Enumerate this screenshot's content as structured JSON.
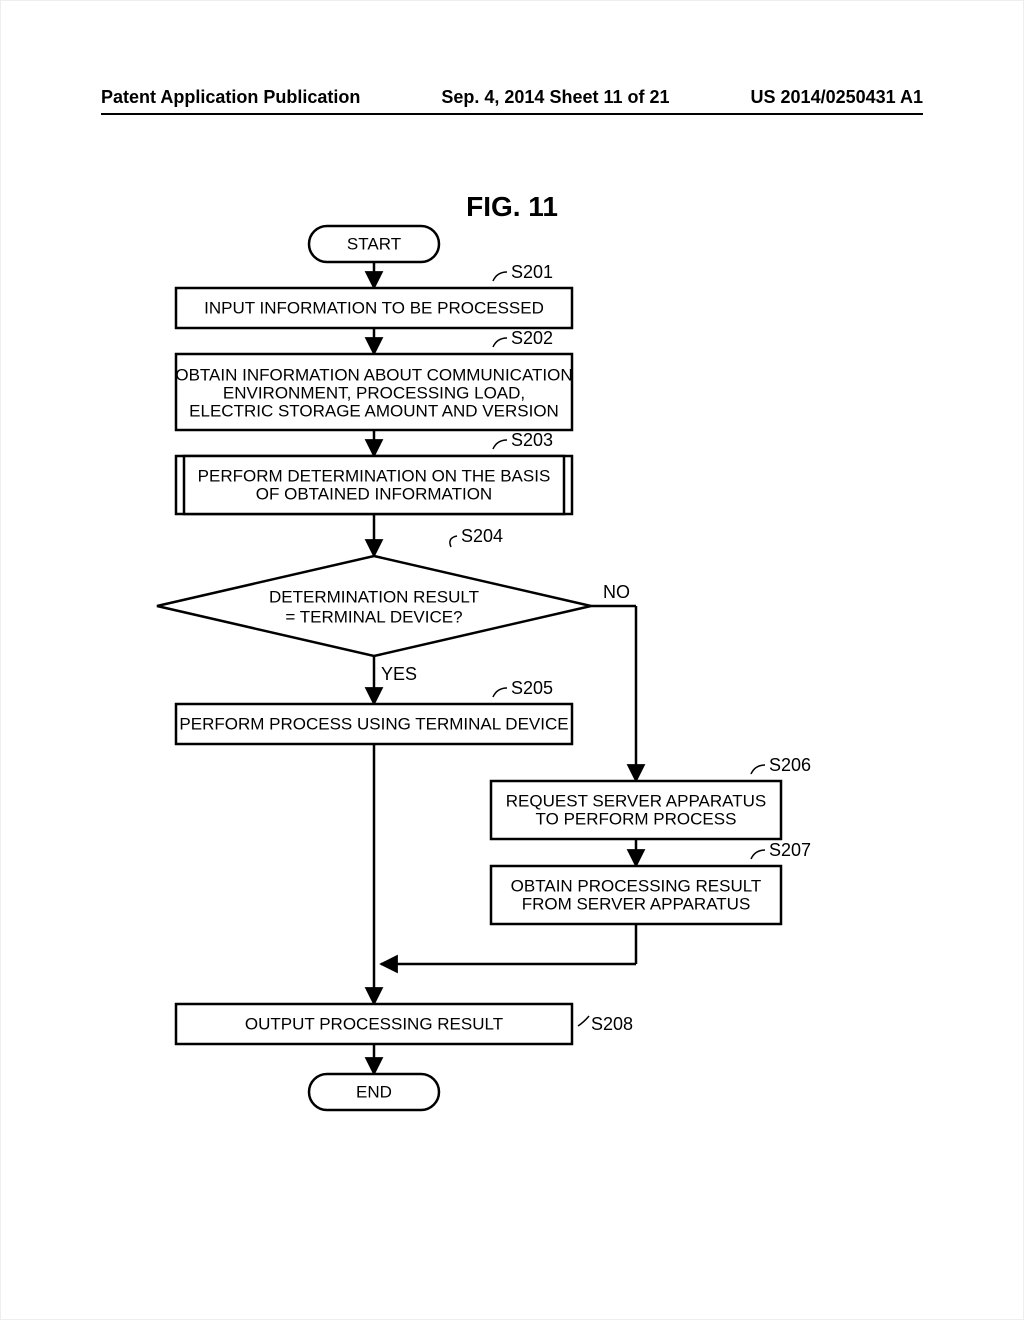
{
  "header": {
    "left": "Patent Application Publication",
    "center": "Sep. 4, 2014  Sheet 11 of 21",
    "right": "US 2014/0250431 A1"
  },
  "figure_title": "FIG. 11",
  "nodes": {
    "start": "START",
    "end": "END",
    "s201": "INPUT INFORMATION TO BE PROCESSED",
    "s202": "OBTAIN INFORMATION ABOUT COMMUNICATION ENVIRONMENT, PROCESSING LOAD, ELECTRIC STORAGE AMOUNT AND VERSION",
    "s203": "PERFORM DETERMINATION ON THE BASIS OF OBTAINED INFORMATION",
    "s204_l1": "DETERMINATION RESULT",
    "s204_l2": "= TERMINAL DEVICE?",
    "s205": "PERFORM PROCESS USING TERMINAL DEVICE",
    "s206_l1": "REQUEST SERVER APPARATUS",
    "s206_l2": "TO PERFORM PROCESS",
    "s207_l1": "OBTAIN PROCESSING RESULT",
    "s207_l2": "FROM SERVER APPARATUS",
    "s208": "OUTPUT PROCESSING RESULT"
  },
  "step_labels": {
    "s201": "S201",
    "s202": "S202",
    "s203": "S203",
    "s204": "S204",
    "s205": "S205",
    "s206": "S206",
    "s207": "S207",
    "s208": "S208"
  },
  "branch": {
    "yes": "YES",
    "no": "NO"
  }
}
